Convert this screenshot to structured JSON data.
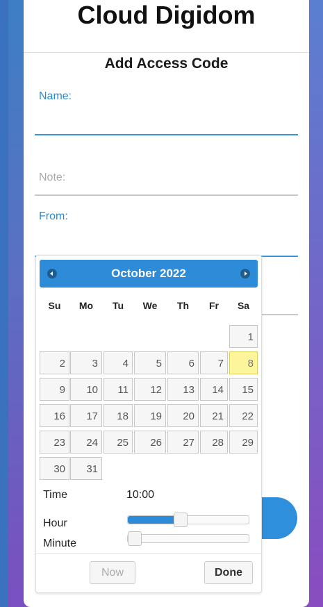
{
  "app": {
    "title": "Cloud Digidom"
  },
  "form": {
    "title": "Add Access Code",
    "name_label": "Name:",
    "note_label": "Note:",
    "from_label": "From:"
  },
  "datepicker": {
    "month_year": "October 2022",
    "weekdays": [
      "Su",
      "Mo",
      "Tu",
      "We",
      "Th",
      "Fr",
      "Sa"
    ],
    "weeks": [
      [
        "",
        "",
        "",
        "",
        "",
        "",
        "1"
      ],
      [
        "2",
        "3",
        "4",
        "5",
        "6",
        "7",
        "8"
      ],
      [
        "9",
        "10",
        "11",
        "12",
        "13",
        "14",
        "15"
      ],
      [
        "16",
        "17",
        "18",
        "19",
        "20",
        "21",
        "22"
      ],
      [
        "23",
        "24",
        "25",
        "26",
        "27",
        "28",
        "29"
      ],
      [
        "30",
        "31",
        "",
        "",
        "",
        "",
        ""
      ]
    ],
    "highlighted_day": "8",
    "time_label": "Time",
    "time_value": "10:00",
    "hour_label": "Hour",
    "minute_label": "Minute",
    "hour_slider_fraction": 0.42,
    "minute_slider_fraction": 0.0,
    "now_button": "Now",
    "done_button": "Done"
  },
  "colors": {
    "accent": "#2d8bd8",
    "highlight_day": "#fdf59b"
  }
}
